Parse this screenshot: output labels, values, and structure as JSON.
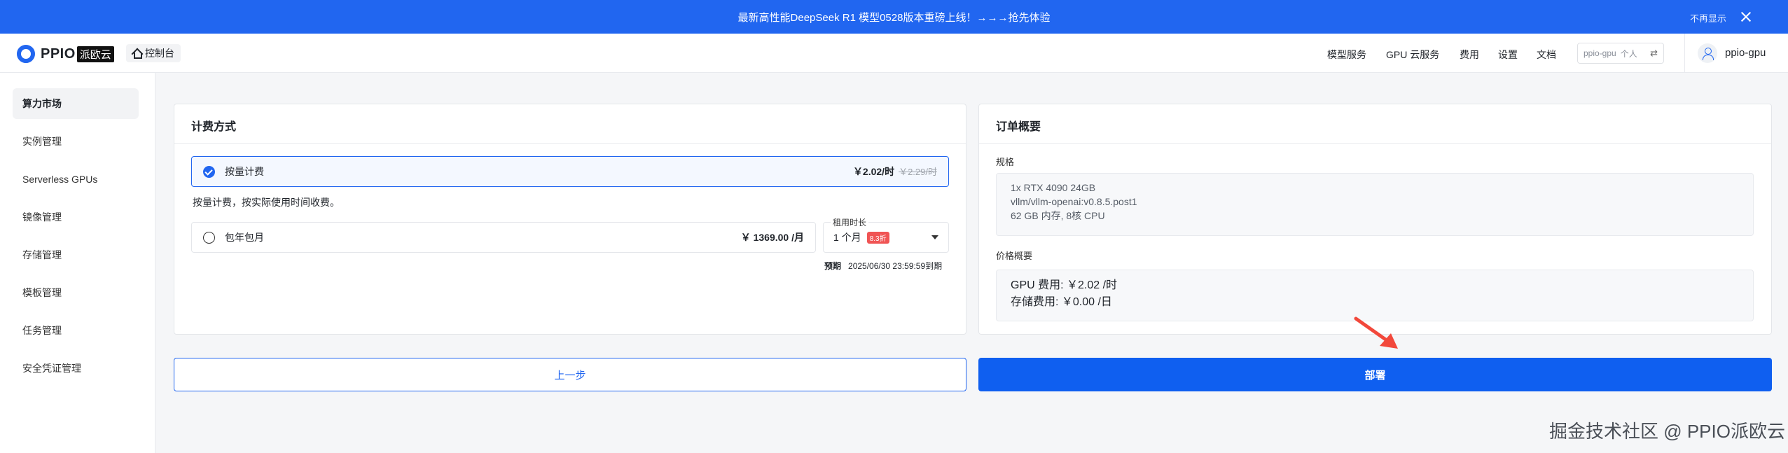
{
  "banner": {
    "text": "最新高性能DeepSeek R1 模型0528版本重磅上线！→→→抢先体验",
    "hide_label": "不再显示"
  },
  "header": {
    "logo_text": "PPIO",
    "logo_badge": "派欧云",
    "console_label": "控制台",
    "nav": [
      "模型服务",
      "GPU 云服务",
      "费用",
      "设置",
      "文档"
    ],
    "account_name": "ppio-gpu",
    "account_type": "个人",
    "username": "ppio-gpu"
  },
  "sidebar": {
    "items": [
      {
        "label": "算力市场",
        "active": true
      },
      {
        "label": "实例管理"
      },
      {
        "label": "Serverless GPUs"
      },
      {
        "label": "镜像管理"
      },
      {
        "label": "存储管理"
      },
      {
        "label": "模板管理"
      },
      {
        "label": "任务管理"
      },
      {
        "label": "安全凭证管理"
      }
    ]
  },
  "billing": {
    "title": "计费方式",
    "option_hourly": {
      "label": "按量计费",
      "price": "￥2.02/时",
      "old_price": "￥2.29/时"
    },
    "hourly_desc": "按量计费，按实际使用时间收费。",
    "option_monthly": {
      "label": "包年包月",
      "price": "￥ 1369.00 /月"
    },
    "duration": {
      "legend": "租用时长",
      "value": "1 个月",
      "discount": "8.3折"
    },
    "expire_label": "预期",
    "expire_value": "2025/06/30 23:59:59到期"
  },
  "summary": {
    "title": "订单概要",
    "spec_label": "规格",
    "spec_lines": [
      "1x RTX 4090 24GB",
      "vllm/vllm-openai:v0.8.5.post1",
      "62 GB 内存, 8核 CPU"
    ],
    "price_label": "价格概要",
    "gpu_fee": "GPU 费用: ￥2.02 /时",
    "storage_fee": "存储费用: ￥0.00 /日"
  },
  "actions": {
    "prev_label": "上一步",
    "deploy_label": "部署"
  },
  "watermark": "掘金技术社区 @ PPIO派欧云",
  "colors": {
    "primary": "#2166f0",
    "deploy": "#0f5ff0",
    "arrow": "#f2483b",
    "discount": "#f05454"
  }
}
